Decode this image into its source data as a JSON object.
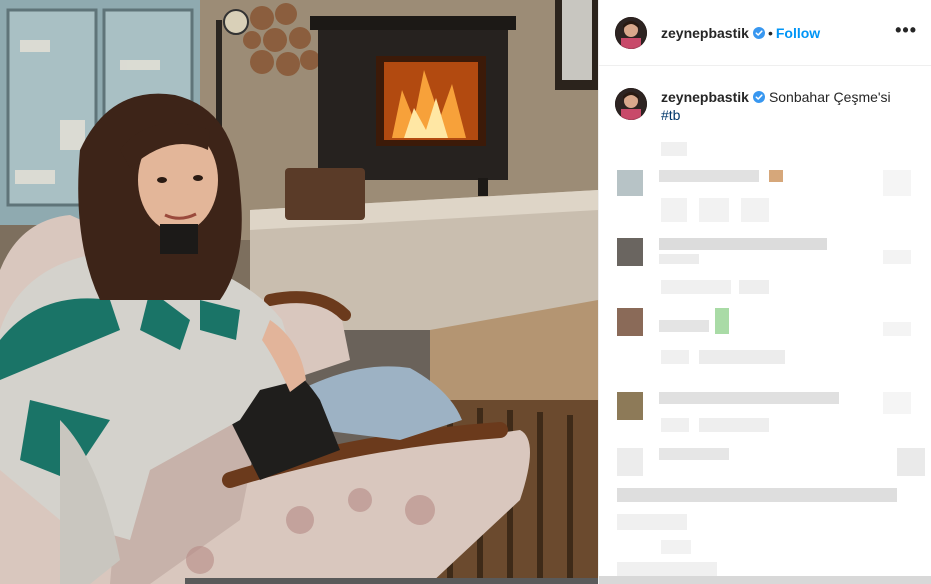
{
  "header": {
    "username": "zeynepbastik",
    "separator": "•",
    "follow_label": "Follow",
    "more_label": "•••"
  },
  "caption": {
    "username": "zeynepbastik",
    "text": "Sonbahar Çeşme'si",
    "hashtag": "#tb"
  },
  "colors": {
    "accent": "#0095f6",
    "verified": "#3897f0",
    "hashtag": "#00376b",
    "text": "#262626"
  },
  "icons": {
    "verified": "verified-badge-icon",
    "more": "more-options-icon"
  }
}
